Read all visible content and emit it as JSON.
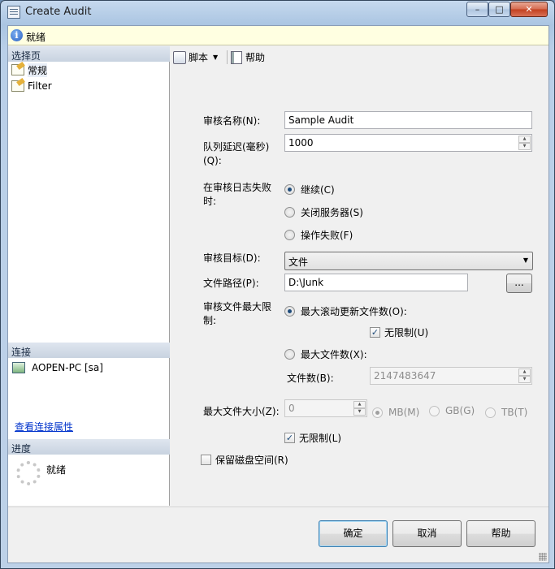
{
  "window": {
    "title": "Create Audit",
    "min": "–",
    "max": "□",
    "close": "✕"
  },
  "status": {
    "text": "就绪"
  },
  "left": {
    "select_page": "选择页",
    "pages": [
      {
        "label": "常规",
        "icon": "page-icon"
      },
      {
        "label": "Filter",
        "icon": "page-icon"
      }
    ],
    "connection_header": "连接",
    "connection": "AOPEN-PC [sa]",
    "view_connection": "查看连接属性",
    "progress_header": "进度",
    "progress_status": "就绪"
  },
  "toolbar": {
    "script": "脚本",
    "help": "帮助"
  },
  "form": {
    "audit_name_label": "审核名称(N):",
    "audit_name": "Sample Audit",
    "queue_delay_label": "队列延迟(毫秒)",
    "queue_delay_label2": "(Q):",
    "queue_delay": "1000",
    "on_failure_label": "在审核日志失败",
    "on_failure_label2": "时:",
    "on_failure_options": [
      "继续(C)",
      "关闭服务器(S)",
      "操作失败(F)"
    ],
    "destination_label": "审核目标(D):",
    "destination": "文件",
    "file_path_label": "文件路径(P):",
    "file_path": "D:\\Junk",
    "browse": "...",
    "max_limit_label": "审核文件最大限",
    "max_limit_label2": "制:",
    "max_rollover": "最大滚动更新文件数(O):",
    "unlimited_u": "无限制(U)",
    "max_files": "最大文件数(X):",
    "file_count_label": "文件数(B):",
    "file_count": "2147483647",
    "max_file_size_label": "最大文件大小(Z):",
    "max_file_size": "0",
    "units": [
      "MB(M)",
      "GB(G)",
      "TB(T)"
    ],
    "unlimited_l": "无限制(L)",
    "reserve_disk": "保留磁盘空间(R)"
  },
  "footer": {
    "ok": "确定",
    "cancel": "取消",
    "help": "帮助"
  }
}
